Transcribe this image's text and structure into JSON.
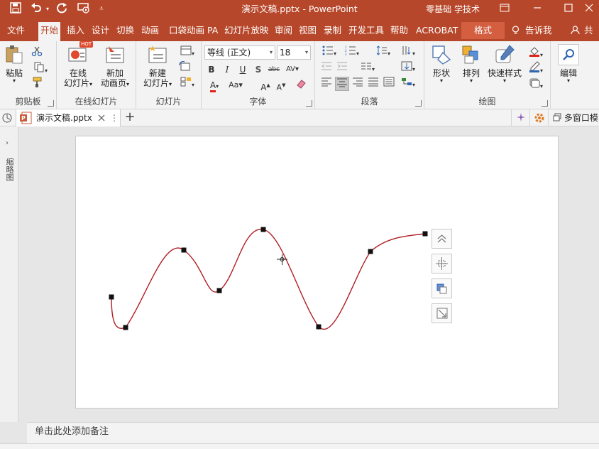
{
  "titlebar": {
    "doc_title": "演示文稿.pptx  -  PowerPoint",
    "user": "零基础 学技术",
    "colors": {
      "accent": "#b7472a",
      "accent_light": "#d35e40"
    }
  },
  "menu_tabs": [
    "文件",
    "开始",
    "插入",
    "设计",
    "切换",
    "动画",
    "口袋动画 PA",
    "幻灯片放映",
    "审阅",
    "视图",
    "录制",
    "开发工具",
    "帮助",
    "ACROBAT",
    "格式"
  ],
  "active_tab": "开始",
  "tell_me": "告诉我",
  "share": "共享",
  "ribbon": {
    "clipboard": {
      "label": "剪贴板",
      "paste": "粘贴"
    },
    "online_slides": {
      "label": "在线幻灯片",
      "btn1_line1": "在线",
      "btn1_line2": "幻灯片",
      "btn2_line1": "新加",
      "btn2_line2": "动画页",
      "hot": "HOT"
    },
    "slides": {
      "label": "幻灯片",
      "new_line1": "新建",
      "new_line2": "幻灯片"
    },
    "font": {
      "label": "字体",
      "font_name": "等线 (正文)",
      "font_size": "18"
    },
    "paragraph": {
      "label": "段落"
    },
    "drawing": {
      "label": "绘图",
      "shape": "形状",
      "arrange": "排列",
      "quick_styles": "快速样式"
    },
    "editing": {
      "label": "编辑"
    }
  },
  "doc_tab": {
    "name": "演示文稿.pptx"
  },
  "multi_window": "多窗口模",
  "left_pane_label": "缩略图",
  "notes_placeholder": "单击此处添加备注",
  "icons": [
    "save-icon",
    "undo-icon",
    "redo-icon",
    "slideshow-icon",
    "paste-icon",
    "cut-icon",
    "copy-icon",
    "format-painter-icon",
    "shape-icon",
    "arrange-icon",
    "quick-styles-icon",
    "search-icon"
  ]
}
